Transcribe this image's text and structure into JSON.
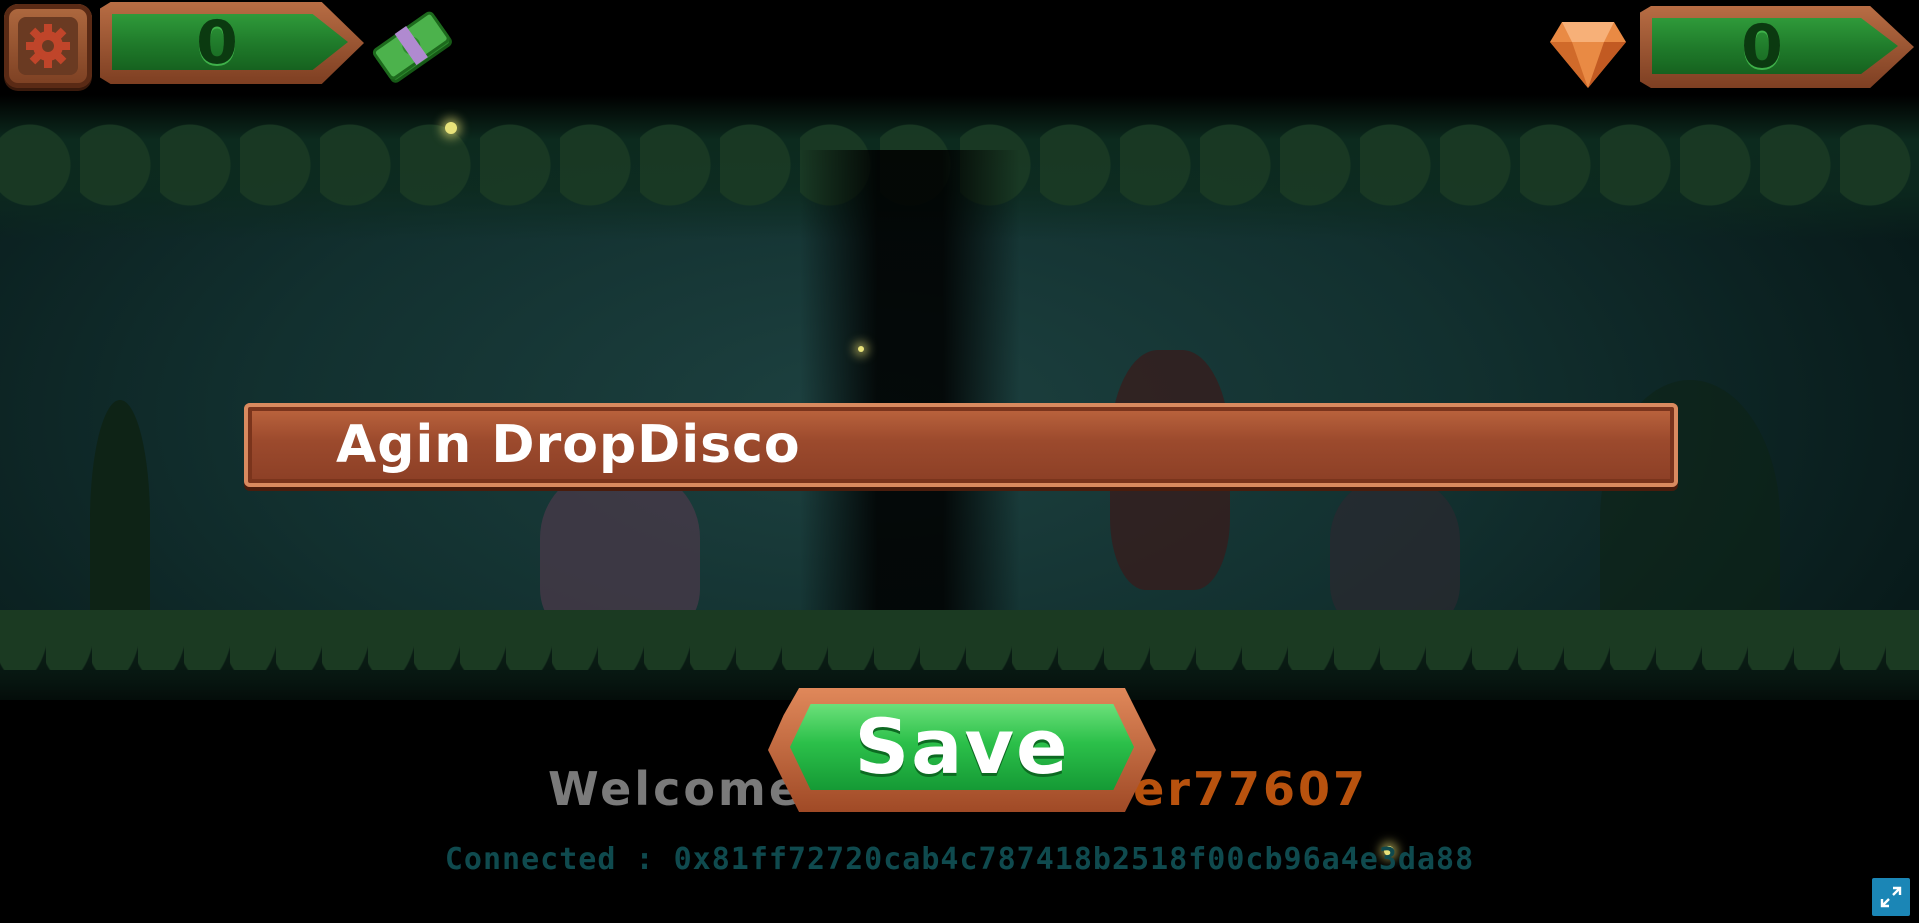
{
  "hud": {
    "cash_count": "0",
    "gem_count": "0",
    "settings_icon": "gear-icon",
    "cash_icon": "cash-icon",
    "gem_icon": "diamond-icon"
  },
  "banner": {
    "name": "Agin DropDisco"
  },
  "save_button": {
    "label": "Save"
  },
  "welcome": {
    "prefix": "Welcome",
    "username": "er77607"
  },
  "connected": {
    "text": "Connected : 0x81ff72720cab4c787418b2518f00cb96a4e3da88"
  },
  "fullscreen_icon": "fullscreen-icon",
  "colors": {
    "accent": "#2cc04a",
    "frame": "#9c4a2d",
    "username": "#b8520e"
  }
}
